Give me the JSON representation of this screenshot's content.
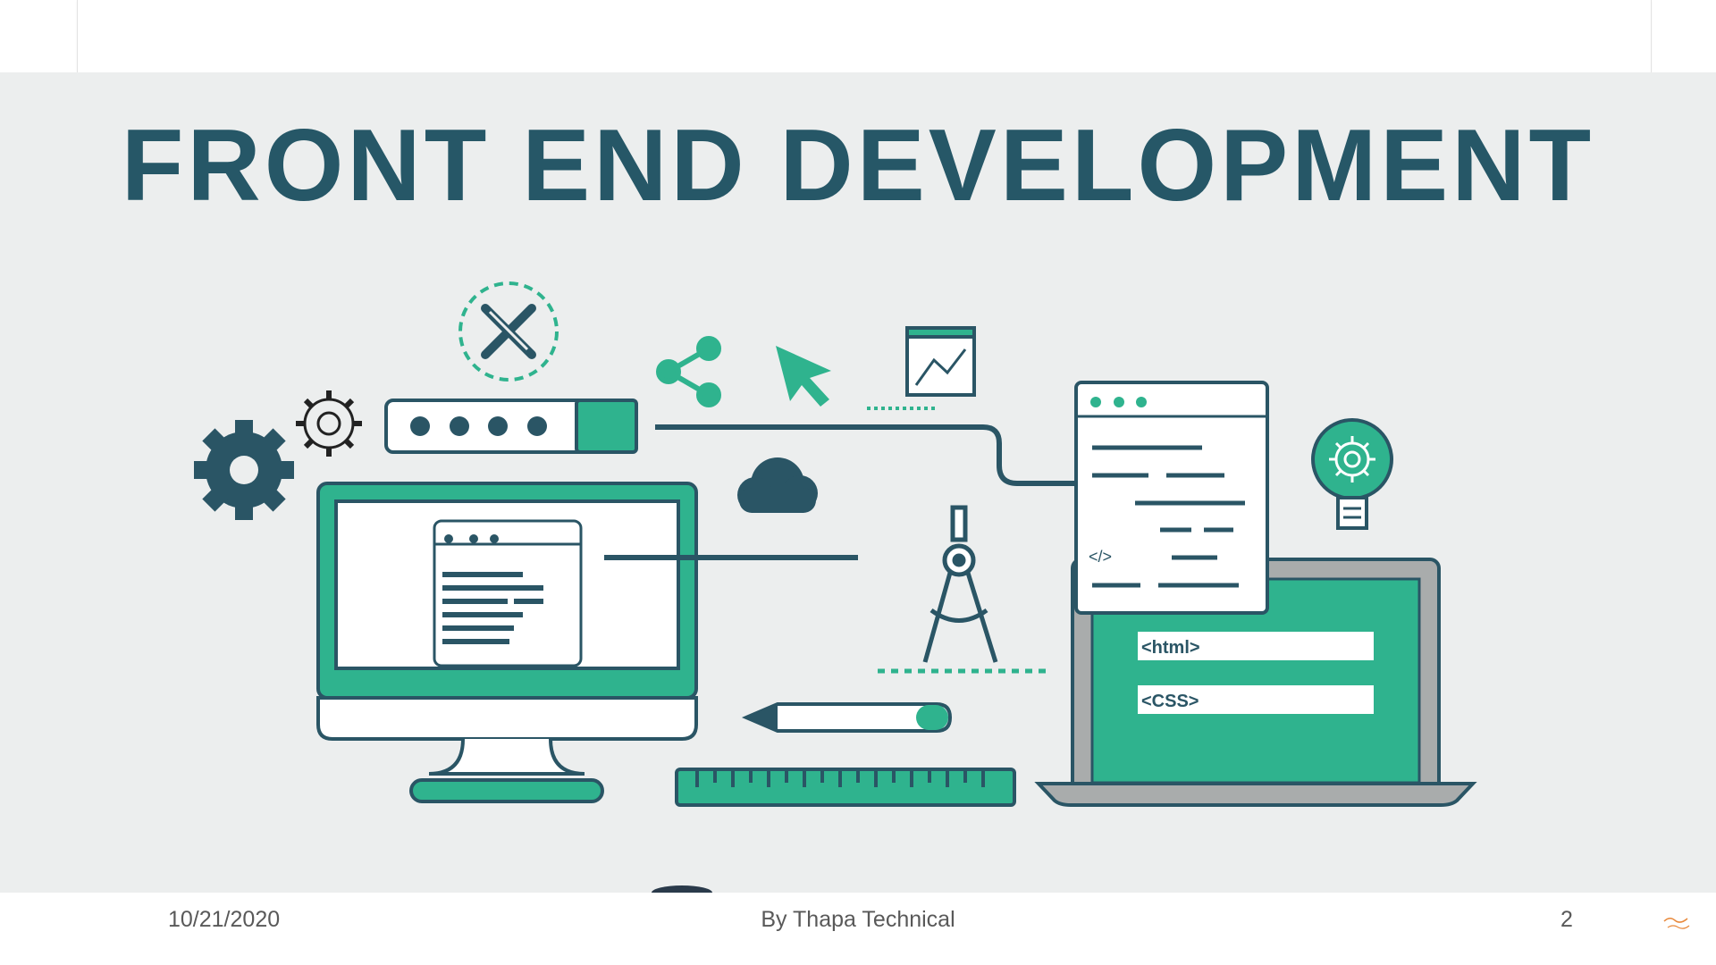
{
  "slide": {
    "title": "FRONT END DEVELOPMENT",
    "illustration_labels": {
      "code_tag": "</>",
      "html_field": "<html>",
      "css_field": "<CSS>"
    }
  },
  "footer": {
    "date": "10/21/2020",
    "text": "By Thapa Technical",
    "page_number": "2"
  },
  "colors": {
    "title": "#265767",
    "teal": "#2fb38e",
    "dark": "#2a5565",
    "background": "#eceeee"
  }
}
